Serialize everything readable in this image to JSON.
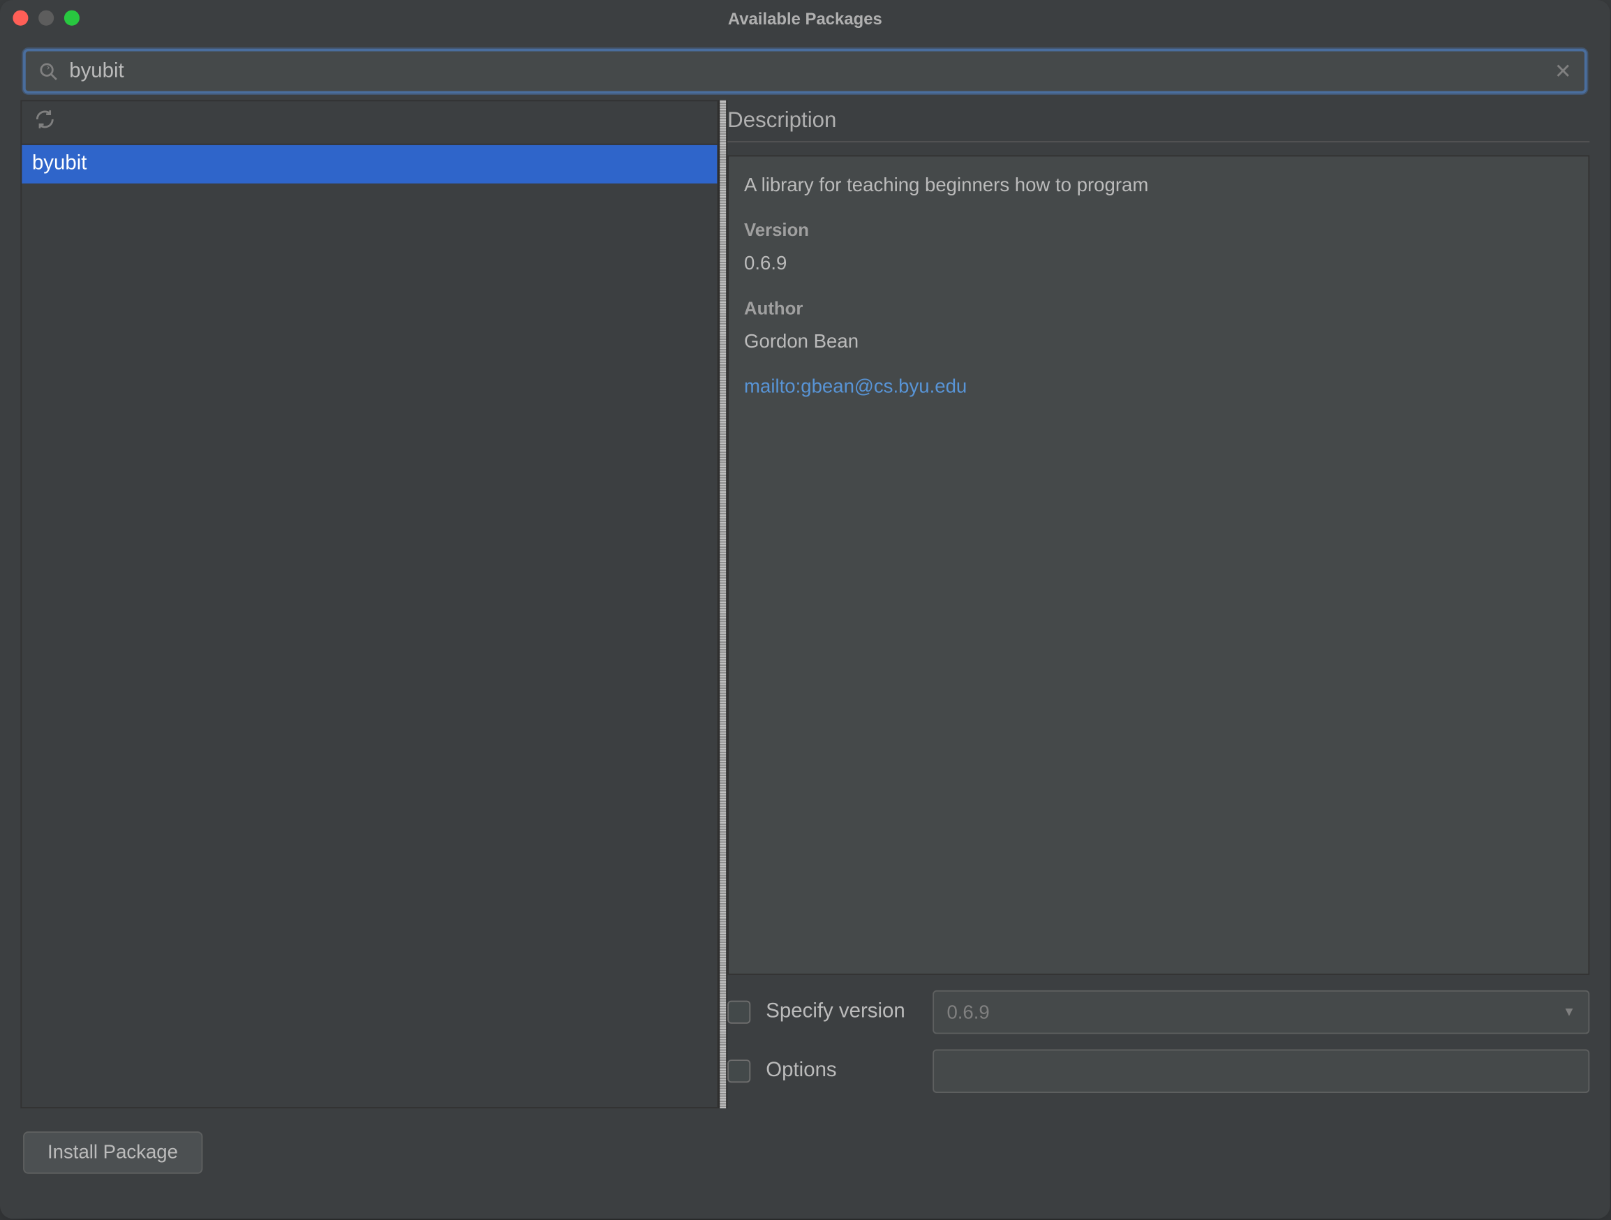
{
  "window": {
    "title": "Available Packages"
  },
  "search": {
    "value": "byubit",
    "placeholder": ""
  },
  "packages": [
    {
      "name": "byubit",
      "selected": true
    }
  ],
  "detail": {
    "header": "Description",
    "summary": "A library for teaching beginners how to program",
    "version_label": "Version",
    "version_value": "0.6.9",
    "author_label": "Author",
    "author_value": "Gordon Bean",
    "link": "mailto:gbean@cs.byu.edu"
  },
  "options": {
    "specify_version_label": "Specify version",
    "specify_version_value": "0.6.9",
    "options_label": "Options",
    "options_value": ""
  },
  "buttons": {
    "install": "Install Package"
  }
}
